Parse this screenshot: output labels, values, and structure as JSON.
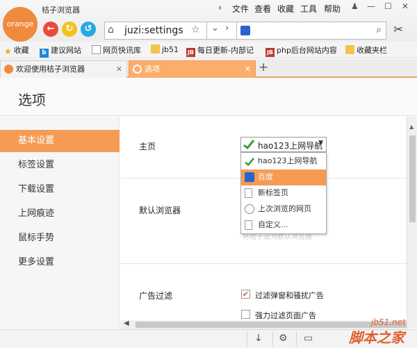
{
  "app": {
    "logo_text": "orange",
    "title": "桔子浏览器"
  },
  "menu": [
    "文件",
    "查看",
    "收藏",
    "工具",
    "帮助"
  ],
  "toolbar": {
    "url": "juzi:settings"
  },
  "bookmarks": {
    "collect_label": "收藏",
    "items": [
      "建议网站",
      "网页快讯库",
      "jb51",
      "每日更新-内部记",
      "php后台网站内容",
      "收藏夹栏"
    ]
  },
  "tabs": [
    {
      "label": "欢迎使用桔子浏览器"
    },
    {
      "label": "选项"
    }
  ],
  "page": {
    "title": "选项"
  },
  "sidebar": {
    "items": [
      {
        "label": "基本设置"
      },
      {
        "label": "标签设置"
      },
      {
        "label": "下载设置"
      },
      {
        "label": "上网痕迹"
      },
      {
        "label": "鼠标手势"
      },
      {
        "label": "更多设置"
      }
    ]
  },
  "settings": {
    "homepage_label": "主页",
    "homepage_value": "hao123上网导航",
    "default_browser_label": "默认浏览器",
    "faint_hint": "将桔子设为默认浏览器",
    "adfilter_label": "广告过滤",
    "adfilter_options": [
      {
        "label": "过滤弹窗和骚扰广告",
        "checked": true
      },
      {
        "label": "强力过滤页面广告",
        "checked": false
      }
    ]
  },
  "homepage_menu": {
    "options": [
      {
        "label": "hao123上网导航",
        "icon": "hao123-icon"
      },
      {
        "label": "百度",
        "icon": "baidu-paw-icon"
      },
      {
        "label": "新标签页",
        "icon": "page-icon"
      },
      {
        "label": "上次浏览的网页",
        "icon": "clock-icon"
      },
      {
        "label": "自定义...",
        "icon": "document-icon"
      }
    ],
    "selected": "百度"
  },
  "watermark": {
    "line1": "jb51.net",
    "line2": "脚本之家"
  },
  "colors": {
    "accent": "#f59b54",
    "back": "#e94b3c",
    "forward": "#f2c21a",
    "refresh": "#27a9e1"
  }
}
